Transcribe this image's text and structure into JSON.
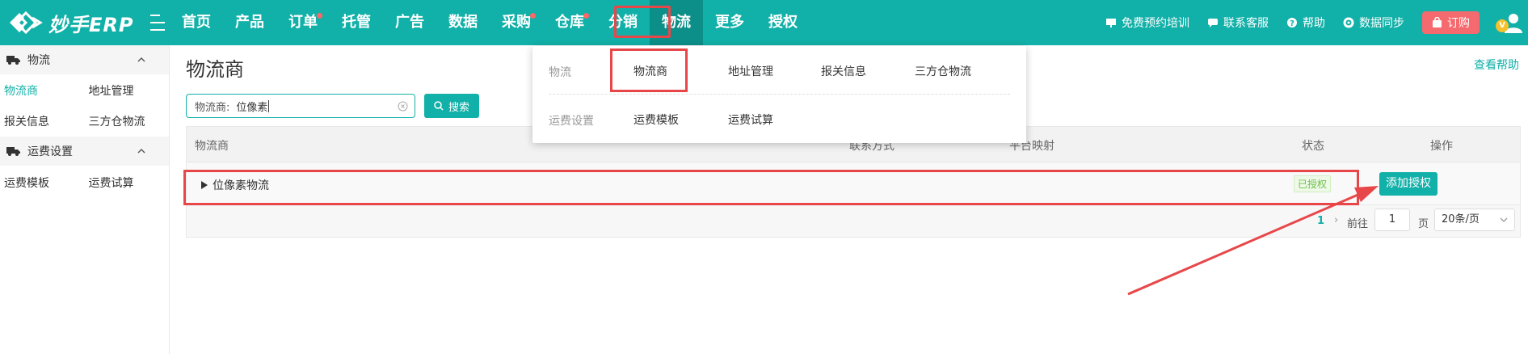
{
  "app": {
    "logo_text": "妙手ERP"
  },
  "nav": {
    "items": [
      {
        "label": "首页",
        "dot": false
      },
      {
        "label": "产品",
        "dot": false
      },
      {
        "label": "订单",
        "dot": true
      },
      {
        "label": "托管",
        "dot": false
      },
      {
        "label": "广告",
        "dot": false
      },
      {
        "label": "数据",
        "dot": false
      },
      {
        "label": "采购",
        "dot": true
      },
      {
        "label": "仓库",
        "dot": true
      },
      {
        "label": "分销",
        "dot": false
      },
      {
        "label": "物流",
        "dot": false,
        "active": true
      },
      {
        "label": "更多",
        "dot": false
      },
      {
        "label": "授权",
        "dot": false
      }
    ]
  },
  "tools": {
    "training": "免费预约培训",
    "support": "联系客服",
    "help": "帮助",
    "sync": "数据同步",
    "subscribe": "订购",
    "vip_badge": "V"
  },
  "sidebar": {
    "group1": "物流",
    "group1_items": [
      "物流商",
      "地址管理",
      "报关信息",
      "三方仓物流"
    ],
    "group2": "运费设置",
    "group2_items": [
      "运费模板",
      "运费试算"
    ]
  },
  "page": {
    "title": "物流商",
    "help_link": "查看帮助",
    "search_label": "物流商:",
    "search_value": "位像素",
    "search_button": "搜索"
  },
  "table": {
    "columns": [
      "物流商",
      "联系方式",
      "平台映射",
      "状态",
      "操作"
    ],
    "rows": [
      {
        "name": "位像素物流",
        "status": "已授权",
        "action": "添加授权"
      }
    ]
  },
  "pagination": {
    "current_page": "1",
    "goto_label": "前往",
    "goto_value": "1",
    "page_unit": "页",
    "page_size": "20条/页"
  },
  "dropdown": {
    "section1_label": "物流",
    "section1_items": [
      "物流商",
      "地址管理",
      "报关信息",
      "三方仓物流"
    ],
    "section2_label": "运费设置",
    "section2_items": [
      "运费模板",
      "运费试算"
    ]
  },
  "colors": {
    "primary": "#11b0a8",
    "highlight": "#e8474a",
    "subscribe": "#f46a6f"
  }
}
